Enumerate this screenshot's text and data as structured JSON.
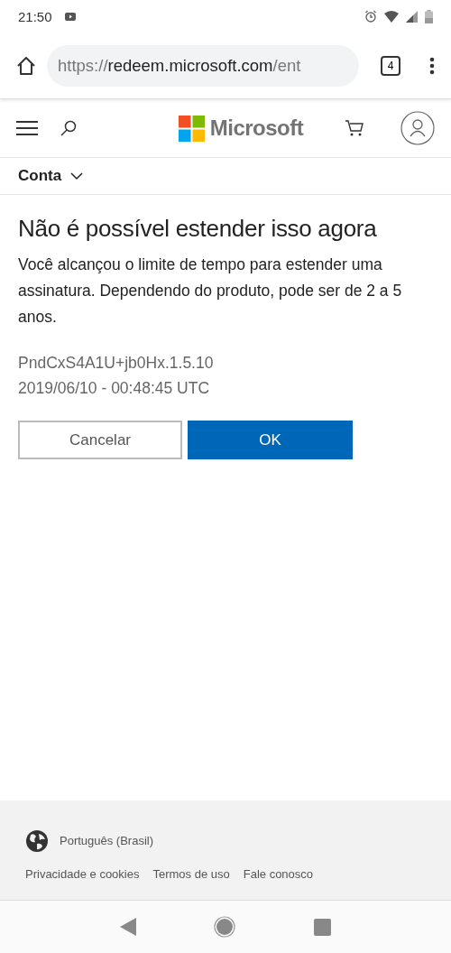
{
  "status_bar": {
    "time": "21:50"
  },
  "browser": {
    "url_scheme": "https://",
    "url_host": "redeem.microsoft.com",
    "url_path": "/ent",
    "tab_count": "4"
  },
  "header": {
    "logo_text": "Microsoft"
  },
  "breadcrumb": {
    "label": "Conta",
    "expanded": false
  },
  "message": {
    "title": "Não é possível estender isso agora",
    "body": "Você alcançou o limite de tempo para estender uma assinatura. Dependendo do produto, pode ser de 2 a 5 anos.",
    "code": "PndCxS4A1U+jb0Hx.1.5.10",
    "timestamp": "2019/06/10 - 00:48:45 UTC"
  },
  "buttons": [
    {
      "label": "Cancelar",
      "kind": "secondary"
    },
    {
      "label": "OK",
      "kind": "primary"
    }
  ],
  "footer": {
    "language": "Português (Brasil)",
    "links": [
      "Privacidade e cookies",
      "Termos de uso",
      "Fale conosco"
    ]
  }
}
